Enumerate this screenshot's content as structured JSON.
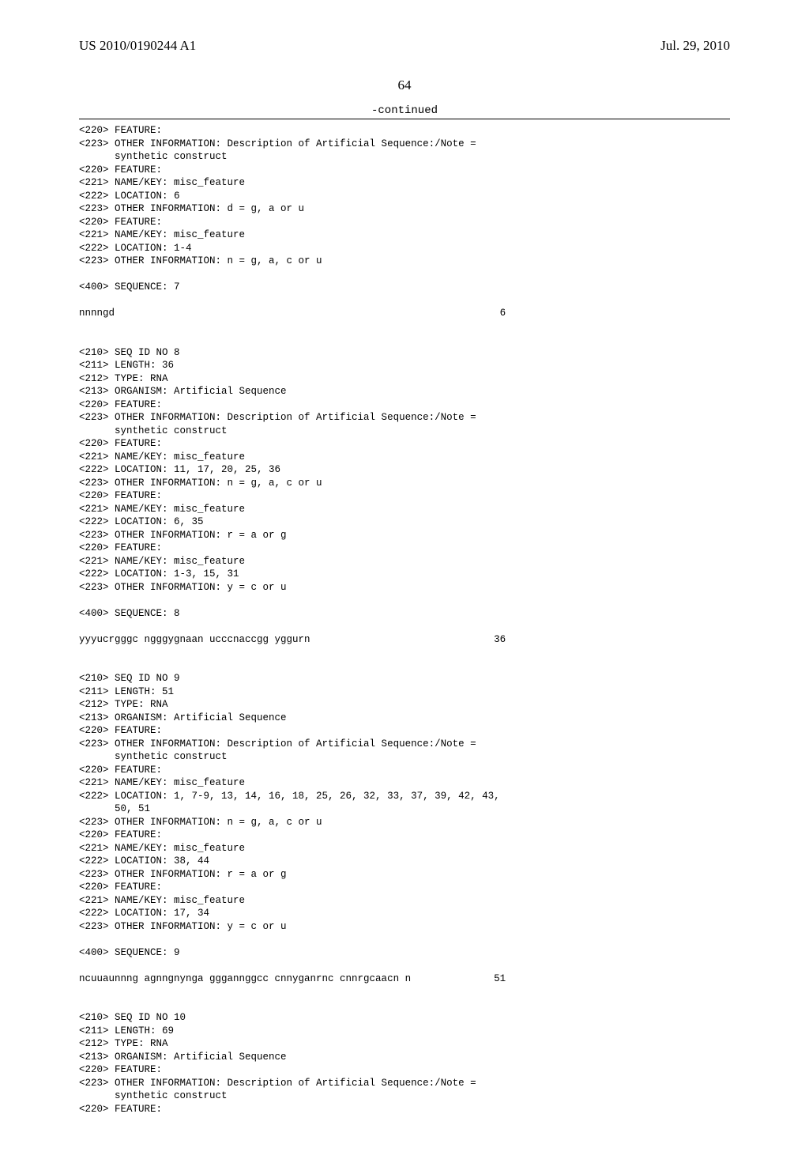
{
  "header": {
    "publication_number": "US 2010/0190244 A1",
    "date": "Jul. 29, 2010"
  },
  "page_number": "64",
  "continued_label": "-continued",
  "listing": "<220> FEATURE:\n<223> OTHER INFORMATION: Description of Artificial Sequence:/Note =\n      synthetic construct\n<220> FEATURE:\n<221> NAME/KEY: misc_feature\n<222> LOCATION: 6\n<223> OTHER INFORMATION: d = g, a or u\n<220> FEATURE:\n<221> NAME/KEY: misc_feature\n<222> LOCATION: 1-4\n<223> OTHER INFORMATION: n = g, a, c or u\n\n<400> SEQUENCE: 7\n\nnnnngd                                                                 6\n\n\n<210> SEQ ID NO 8\n<211> LENGTH: 36\n<212> TYPE: RNA\n<213> ORGANISM: Artificial Sequence\n<220> FEATURE:\n<223> OTHER INFORMATION: Description of Artificial Sequence:/Note =\n      synthetic construct\n<220> FEATURE:\n<221> NAME/KEY: misc_feature\n<222> LOCATION: 11, 17, 20, 25, 36\n<223> OTHER INFORMATION: n = g, a, c or u\n<220> FEATURE:\n<221> NAME/KEY: misc_feature\n<222> LOCATION: 6, 35\n<223> OTHER INFORMATION: r = a or g\n<220> FEATURE:\n<221> NAME/KEY: misc_feature\n<222> LOCATION: 1-3, 15, 31\n<223> OTHER INFORMATION: y = c or u\n\n<400> SEQUENCE: 8\n\nyyyucrgggc ngggygnaan ucccnaccgg yggurn                               36\n\n\n<210> SEQ ID NO 9\n<211> LENGTH: 51\n<212> TYPE: RNA\n<213> ORGANISM: Artificial Sequence\n<220> FEATURE:\n<223> OTHER INFORMATION: Description of Artificial Sequence:/Note =\n      synthetic construct\n<220> FEATURE:\n<221> NAME/KEY: misc_feature\n<222> LOCATION: 1, 7-9, 13, 14, 16, 18, 25, 26, 32, 33, 37, 39, 42, 43,\n      50, 51\n<223> OTHER INFORMATION: n = g, a, c or u\n<220> FEATURE:\n<221> NAME/KEY: misc_feature\n<222> LOCATION: 38, 44\n<223> OTHER INFORMATION: r = a or g\n<220> FEATURE:\n<221> NAME/KEY: misc_feature\n<222> LOCATION: 17, 34\n<223> OTHER INFORMATION: y = c or u\n\n<400> SEQUENCE: 9\n\nncuuaunnng agnngnynga gggannggcc cnnyganrnc cnnrgcaacn n              51\n\n\n<210> SEQ ID NO 10\n<211> LENGTH: 69\n<212> TYPE: RNA\n<213> ORGANISM: Artificial Sequence\n<220> FEATURE:\n<223> OTHER INFORMATION: Description of Artificial Sequence:/Note =\n      synthetic construct\n<220> FEATURE:"
}
